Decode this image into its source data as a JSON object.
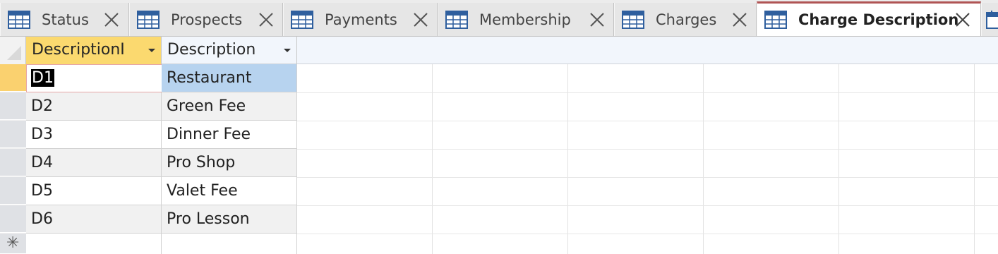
{
  "tabs": [
    {
      "label": "Status",
      "icon": "table-icon"
    },
    {
      "label": "Prospects",
      "icon": "table-icon"
    },
    {
      "label": "Payments",
      "icon": "table-icon"
    },
    {
      "label": "Membership",
      "icon": "table-icon"
    },
    {
      "label": "Charges",
      "icon": "table-icon"
    },
    {
      "label": "Charge Description",
      "icon": "table-icon",
      "active": true
    }
  ],
  "table": {
    "columns": [
      "DescriptionI",
      "Description"
    ],
    "rows": [
      [
        "D1",
        "Restaurant"
      ],
      [
        "D2",
        "Green Fee"
      ],
      [
        "D3",
        "Dinner Fee"
      ],
      [
        "D4",
        "Pro Shop"
      ],
      [
        "D5",
        "Valet Fee"
      ],
      [
        "D6",
        "Pro Lesson"
      ]
    ],
    "new_record_marker": "✳"
  },
  "colors": {
    "active_tab_accent": "#b05454",
    "selected_header": "#fbd96f",
    "current_row_selector": "#fad16f",
    "highlight_cell": "#b7d3ef"
  }
}
